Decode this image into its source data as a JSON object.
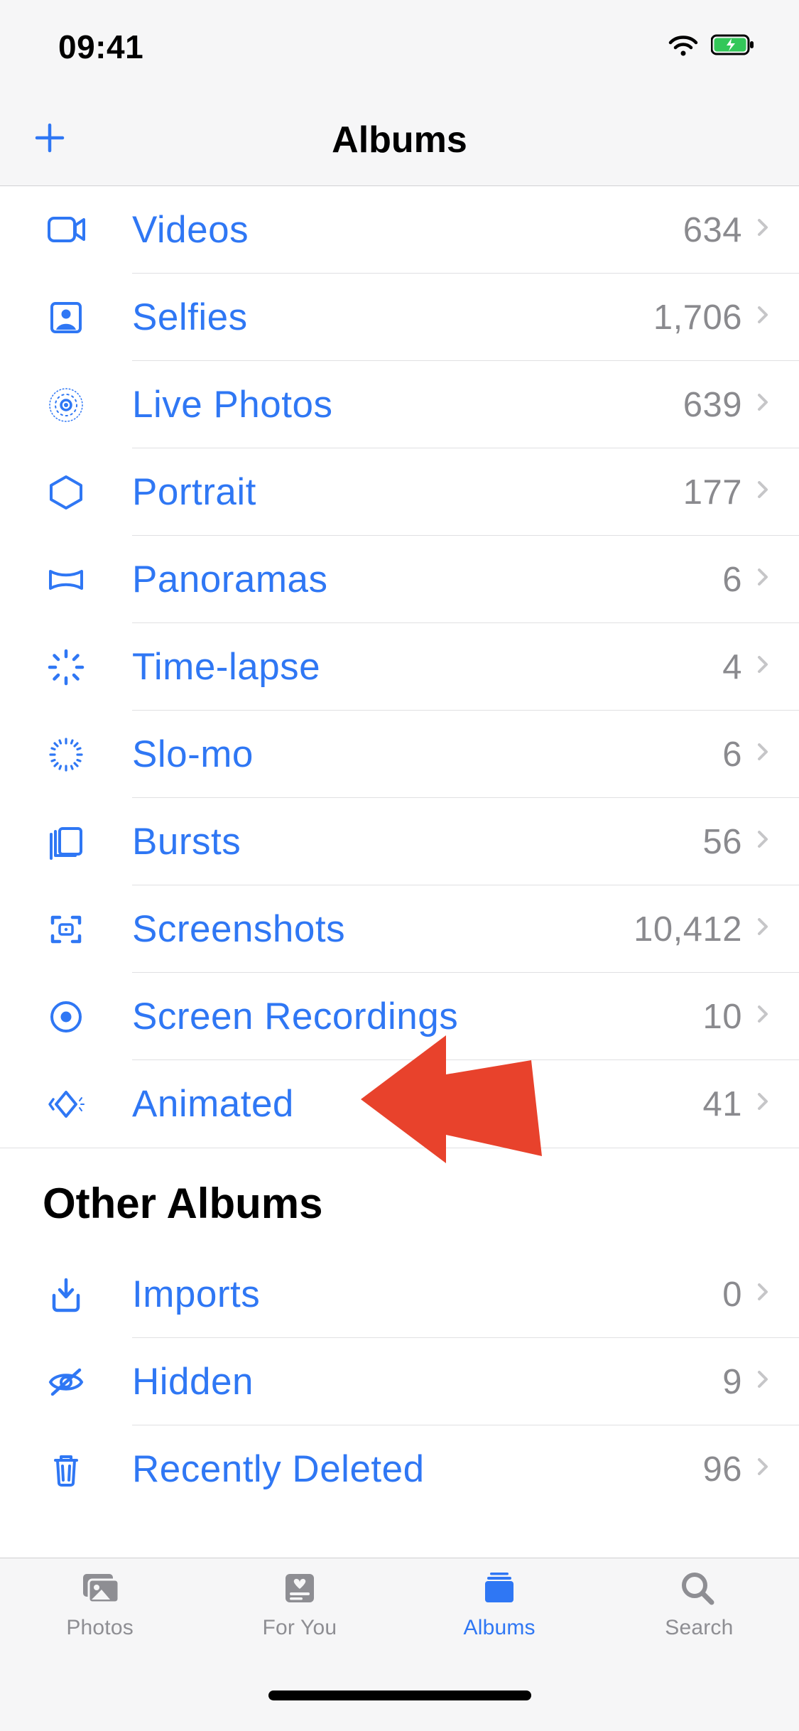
{
  "status": {
    "time": "09:41"
  },
  "nav": {
    "title": "Albums"
  },
  "sections": {
    "media_types": [
      {
        "icon": "video",
        "label": "Videos",
        "count": "634"
      },
      {
        "icon": "selfie",
        "label": "Selfies",
        "count": "1,706"
      },
      {
        "icon": "live",
        "label": "Live Photos",
        "count": "639"
      },
      {
        "icon": "portrait",
        "label": "Portrait",
        "count": "177"
      },
      {
        "icon": "panorama",
        "label": "Panoramas",
        "count": "6"
      },
      {
        "icon": "timelapse",
        "label": "Time-lapse",
        "count": "4"
      },
      {
        "icon": "slomo",
        "label": "Slo-mo",
        "count": "6"
      },
      {
        "icon": "bursts",
        "label": "Bursts",
        "count": "56"
      },
      {
        "icon": "screenshots",
        "label": "Screenshots",
        "count": "10,412"
      },
      {
        "icon": "record",
        "label": "Screen Recordings",
        "count": "10"
      },
      {
        "icon": "animated",
        "label": "Animated",
        "count": "41"
      }
    ],
    "other_title": "Other Albums",
    "other": [
      {
        "icon": "imports",
        "label": "Imports",
        "count": "0"
      },
      {
        "icon": "hidden",
        "label": "Hidden",
        "count": "9"
      },
      {
        "icon": "deleted",
        "label": "Recently Deleted",
        "count": "96"
      }
    ]
  },
  "tabs": [
    {
      "icon": "photos",
      "label": "Photos"
    },
    {
      "icon": "foryou",
      "label": "For You"
    },
    {
      "icon": "albums",
      "label": "Albums"
    },
    {
      "icon": "search",
      "label": "Search"
    }
  ],
  "active_tab": 2
}
